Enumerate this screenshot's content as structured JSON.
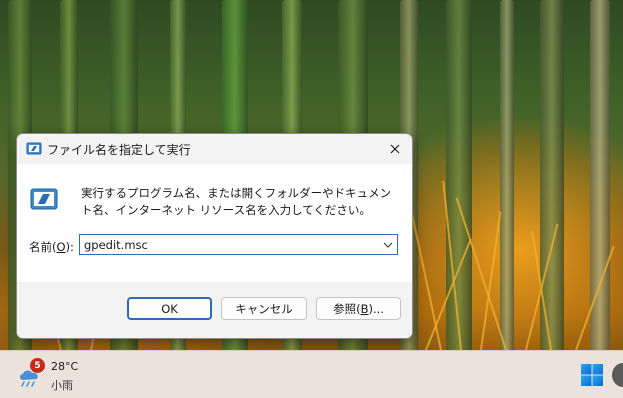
{
  "dialog": {
    "title": "ファイル名を指定して実行",
    "description": "実行するプログラム名、または開くフォルダーやドキュメント名、インターネット リソース名を入力してください。",
    "open_label_pre": "名前(",
    "open_label_key": "O",
    "open_label_post": "):",
    "open_value": "gpedit.msc",
    "ok_label": "OK",
    "cancel_label": "キャンセル",
    "browse_label_pre": "参照(",
    "browse_label_key": "B",
    "browse_label_post": ")..."
  },
  "taskbar": {
    "weather_badge": "5",
    "temperature": "28°C",
    "condition": "小雨"
  },
  "colors": {
    "accent": "#2b6cb3",
    "dialog_bg": "#f3f3f3",
    "taskbar_bg": "#ebe2dc",
    "badge": "#c42b1c"
  },
  "icons": {
    "title": "run-icon",
    "close": "close-icon",
    "combo": "chevron-down-icon",
    "weather": "weather-cloud-rain-icon",
    "start": "windows-start-icon"
  }
}
